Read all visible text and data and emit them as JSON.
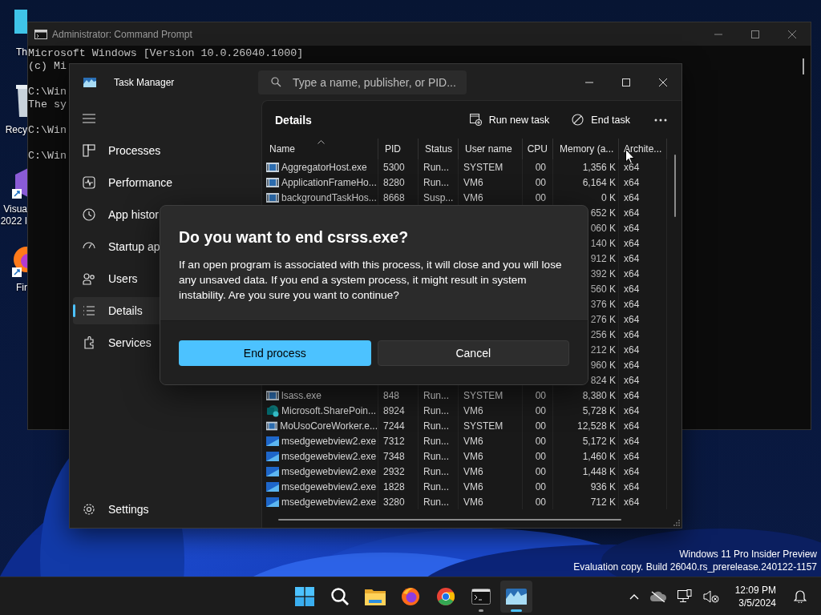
{
  "desktop": {
    "icons": [
      {
        "kind": "pc",
        "label": [
          "Th"
        ]
      },
      {
        "kind": "recycle",
        "label": [
          "Recy"
        ]
      },
      {
        "kind": "vs",
        "label": [
          "Visua",
          "2022 I"
        ]
      },
      {
        "kind": "firefox",
        "label": [
          "Fir"
        ]
      }
    ],
    "watermark": [
      "Windows 11 Pro Insider Preview",
      "Evaluation copy. Build 26040.rs_prerelease.240122-1157"
    ]
  },
  "command_prompt": {
    "title": "Administrator: Command Prompt",
    "blocks": [
      [
        "Microsoft Windows [Version 10.0.26040.1000]",
        "(c) Mi"
      ],
      [
        "C:\\Win",
        "The sy"
      ],
      [
        "C:\\Win"
      ],
      [
        "C:\\Win"
      ]
    ]
  },
  "task_manager": {
    "title": "Task Manager",
    "search": {
      "placeholder": "Type a name, publisher, or PID..."
    },
    "sidebar": {
      "items": [
        {
          "label": "Processes",
          "selected": false
        },
        {
          "label": "Performance",
          "selected": false
        },
        {
          "label": "App histor",
          "selected": false
        },
        {
          "label": "Startup ap",
          "selected": false
        },
        {
          "label": "Users",
          "selected": false
        },
        {
          "label": "Details",
          "selected": true
        },
        {
          "label": "Services",
          "selected": false
        }
      ],
      "footer": "Settings"
    },
    "page_title": "Details",
    "toolbar": [
      "Run new task",
      "End task"
    ],
    "table": {
      "columns": [
        {
          "label": "Name",
          "sorted": true
        },
        {
          "label": "PID",
          "sorted": false
        },
        {
          "label": "Status",
          "sorted": false
        },
        {
          "label": "User name",
          "sorted": false
        },
        {
          "label": "CPU",
          "sorted": false
        },
        {
          "label": "Memory (a...",
          "sorted": false
        },
        {
          "label": "Archite...",
          "sorted": false
        }
      ],
      "rows": [
        {
          "kind": "app",
          "name": "AggregatorHost.exe",
          "pid": "5300",
          "status": "Run...",
          "user": "SYSTEM",
          "cpu": "00",
          "memory": "1,356 K",
          "arch": "x64"
        },
        {
          "kind": "app",
          "name": "ApplicationFrameHo...",
          "pid": "8280",
          "status": "Run...",
          "user": "VM6",
          "cpu": "00",
          "memory": "6,164 K",
          "arch": "x64"
        },
        {
          "kind": "app",
          "name": "backgroundTaskHos...",
          "pid": "8668",
          "status": "Susp...",
          "user": "VM6",
          "cpu": "00",
          "memory": "0 K",
          "arch": "x64"
        },
        {
          "memory": "652 K",
          "arch": "x64"
        },
        {
          "memory": "060 K",
          "arch": "x64"
        },
        {
          "memory": "140 K",
          "arch": "x64"
        },
        {
          "memory": "912 K",
          "arch": "x64"
        },
        {
          "memory": "392 K",
          "arch": "x64"
        },
        {
          "memory": "560 K",
          "arch": "x64"
        },
        {
          "memory": "376 K",
          "arch": "x64"
        },
        {
          "memory": "276 K",
          "arch": "x64"
        },
        {
          "memory": "256 K",
          "arch": "x64"
        },
        {
          "memory": "212 K",
          "arch": "x64"
        },
        {
          "memory": "960 K",
          "arch": "x64"
        },
        {
          "memory": "824 K",
          "arch": "x64"
        },
        {
          "kind": "app",
          "name": "lsass.exe",
          "pid": "848",
          "status": "Run...",
          "user": "SYSTEM",
          "cpu": "00",
          "memory": "8,380 K",
          "arch": "x64"
        },
        {
          "kind": "sharepoint",
          "name": "Microsoft.SharePoin...",
          "pid": "8924",
          "status": "Run...",
          "user": "VM6",
          "cpu": "00",
          "memory": "5,728 K",
          "arch": "x64"
        },
        {
          "kind": "app",
          "name": "MoUsoCoreWorker.e...",
          "pid": "7244",
          "status": "Run...",
          "user": "SYSTEM",
          "cpu": "00",
          "memory": "12,528 K",
          "arch": "x64"
        },
        {
          "kind": "webview",
          "name": "msedgewebview2.exe",
          "pid": "7312",
          "status": "Run...",
          "user": "VM6",
          "cpu": "00",
          "memory": "5,172 K",
          "arch": "x64"
        },
        {
          "kind": "webview",
          "name": "msedgewebview2.exe",
          "pid": "7348",
          "status": "Run...",
          "user": "VM6",
          "cpu": "00",
          "memory": "1,460 K",
          "arch": "x64"
        },
        {
          "kind": "webview",
          "name": "msedgewebview2.exe",
          "pid": "2932",
          "status": "Run...",
          "user": "VM6",
          "cpu": "00",
          "memory": "1,448 K",
          "arch": "x64"
        },
        {
          "kind": "webview",
          "name": "msedgewebview2.exe",
          "pid": "1828",
          "status": "Run...",
          "user": "VM6",
          "cpu": "00",
          "memory": "936 K",
          "arch": "x64"
        },
        {
          "kind": "webview",
          "name": "msedgewebview2.exe",
          "pid": "3280",
          "status": "Run...",
          "user": "VM6",
          "cpu": "00",
          "memory": "712 K",
          "arch": "x64"
        }
      ]
    }
  },
  "dialog": {
    "title": "Do you want to end csrss.exe?",
    "message": "If an open program is associated with this process, it will close and you will lose any unsaved data. If you end a system process, it might result in system instability. Are you sure you want to continue?",
    "buttons": [
      {
        "kind": "primary",
        "label": "End process"
      },
      {
        "kind": "secondary",
        "label": "Cancel"
      }
    ]
  },
  "taskbar": {
    "apps": [
      {
        "kind": "start",
        "running": false,
        "active": false
      },
      {
        "kind": "search",
        "running": false,
        "active": false
      },
      {
        "kind": "explorer",
        "running": false,
        "active": false
      },
      {
        "kind": "firefox",
        "running": false,
        "active": false
      },
      {
        "kind": "chrome",
        "running": false,
        "active": false
      },
      {
        "kind": "terminal",
        "running": true,
        "active": false
      },
      {
        "kind": "taskmanager",
        "running": true,
        "active": true
      }
    ],
    "time": "12:09 PM",
    "date": "3/5/2024"
  }
}
